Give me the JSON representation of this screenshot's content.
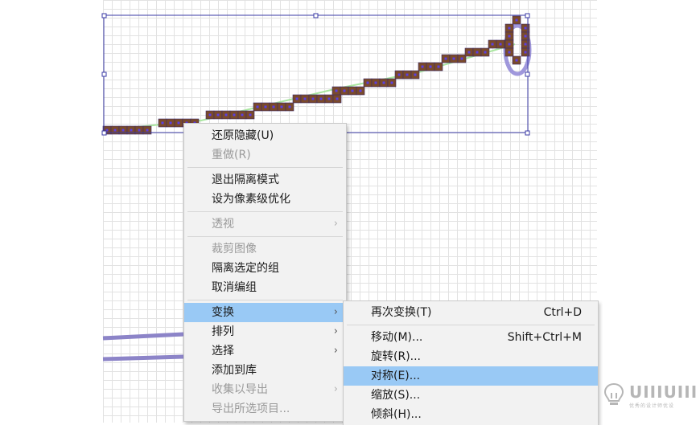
{
  "colors": {
    "highlight": "#99c9f5",
    "selection": "#3a3aa6",
    "pixel_fill": "#7a4a2a",
    "pixel_dot": "#5b3fe0",
    "menu_bg": "#f2f2f2"
  },
  "context_menu": {
    "items": [
      {
        "label": "还原隐藏(U)",
        "enabled": true
      },
      {
        "label": "重做(R)",
        "enabled": false
      },
      {
        "label": "退出隔离模式",
        "enabled": true
      },
      {
        "label": "设为像素级优化",
        "enabled": true
      },
      {
        "label": "透视",
        "enabled": false,
        "submenu": true
      },
      {
        "label": "裁剪图像",
        "enabled": false
      },
      {
        "label": "隔离选定的组",
        "enabled": true
      },
      {
        "label": "取消编组",
        "enabled": true
      },
      {
        "label": "变换",
        "enabled": true,
        "submenu": true,
        "highlighted": true
      },
      {
        "label": "排列",
        "enabled": true,
        "submenu": true
      },
      {
        "label": "选择",
        "enabled": true,
        "submenu": true
      },
      {
        "label": "添加到库",
        "enabled": true
      },
      {
        "label": "收集以导出",
        "enabled": false,
        "submenu": true
      },
      {
        "label": "导出所选项目...",
        "enabled": false
      }
    ],
    "submenu_arrow": "›"
  },
  "transform_submenu": {
    "items": [
      {
        "label": "再次变换(T)",
        "shortcut": "Ctrl+D"
      },
      {
        "label": "移动(M)...",
        "shortcut": "Shift+Ctrl+M"
      },
      {
        "label": "旋转(R)..."
      },
      {
        "label": "对称(E)...",
        "highlighted": true
      },
      {
        "label": "缩放(S)..."
      },
      {
        "label": "倾斜(H)..."
      }
    ]
  },
  "watermark": {
    "icon": "lightbulb-icon",
    "text": "UIIIUIII",
    "subtext": "优秀的设计师优设"
  }
}
